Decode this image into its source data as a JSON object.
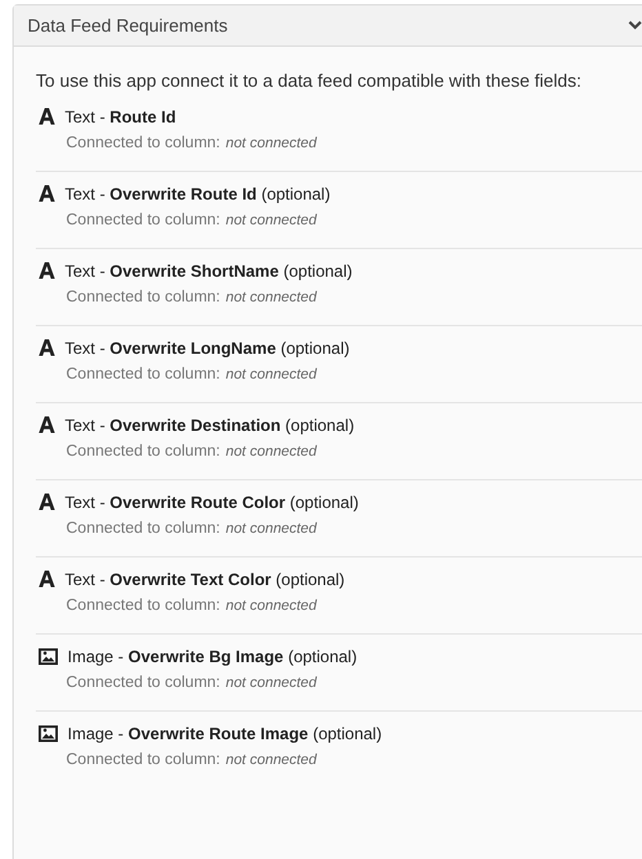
{
  "panel": {
    "title": "Data Feed Requirements",
    "expanded": true,
    "intro": "To use this app connect it to a data feed compatible with these fields:",
    "fields": [
      {
        "kind": "text",
        "label": "Text - **Route Id**",
        "connection_label": "Connected to column:",
        "connection_value": "not connected"
      },
      {
        "kind": "text",
        "label": "Text - **Overwrite Route Id** (optional)",
        "connection_label": "Connected to column:",
        "connection_value": "not connected"
      },
      {
        "kind": "text",
        "label": "Text - **Overwrite ShortName** (optional)",
        "connection_label": "Connected to column:",
        "connection_value": "not connected"
      },
      {
        "kind": "text",
        "label": "Text - **Overwrite LongName** (optional)",
        "connection_label": "Connected to column:",
        "connection_value": "not connected"
      },
      {
        "kind": "text",
        "label": "Text - **Overwrite Destination** (optional)",
        "connection_label": "Connected to column:",
        "connection_value": "not connected"
      },
      {
        "kind": "text",
        "label": "Text - **Overwrite Route Color** (optional)",
        "connection_label": "Connected to column:",
        "connection_value": "not connected"
      },
      {
        "kind": "text",
        "label": "Text - **Overwrite Text Color** (optional)",
        "connection_label": "Connected to column:",
        "connection_value": "not connected"
      },
      {
        "kind": "image",
        "label": "Image - **Overwrite Bg Image** (optional)",
        "connection_label": "Connected to column:",
        "connection_value": "not connected"
      },
      {
        "kind": "image",
        "label": "Image - **Overwrite Route Image** (optional)",
        "connection_label": "Connected to column:",
        "connection_value": "not connected"
      }
    ]
  }
}
